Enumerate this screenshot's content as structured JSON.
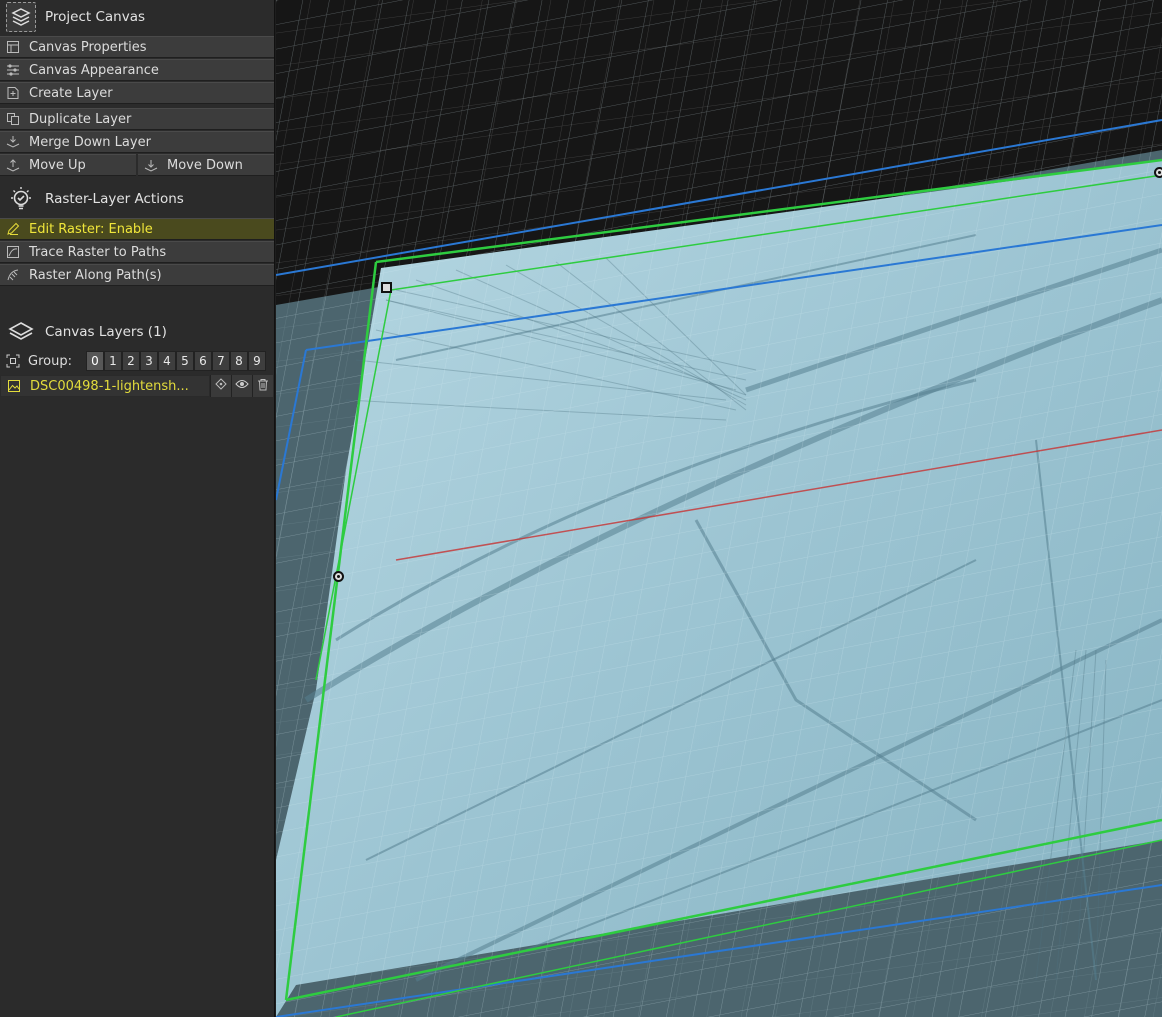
{
  "header": {
    "title": "Project Canvas",
    "icon": "canvas-stack-icon"
  },
  "canvas_actions": [
    {
      "label": "Canvas Properties",
      "icon": "canvas-properties-icon"
    },
    {
      "label": "Canvas Appearance",
      "icon": "sliders-icon"
    },
    {
      "label": "Create Layer",
      "icon": "create-layer-icon"
    },
    {
      "label": "Duplicate Layer",
      "icon": "duplicate-icon"
    },
    {
      "label": "Merge Down Layer",
      "icon": "merge-down-icon"
    }
  ],
  "move": {
    "up_label": "Move Up",
    "down_label": "Move Down"
  },
  "raster_section": {
    "title": "Raster-Layer Actions",
    "icon": "lightbulb-icon"
  },
  "raster_actions": [
    {
      "label": "Edit Raster: Enable",
      "icon": "pencil-icon",
      "active": true
    },
    {
      "label": "Trace Raster to Paths",
      "icon": "trace-icon"
    },
    {
      "label": "Raster Along Path(s)",
      "icon": "raster-path-icon"
    }
  ],
  "layers_section": {
    "title": "Canvas Layers (1)",
    "icon": "layers-icon"
  },
  "group": {
    "label": "Group:",
    "numbers": [
      "0",
      "1",
      "2",
      "3",
      "4",
      "5",
      "6",
      "7",
      "8",
      "9"
    ],
    "selected": "0"
  },
  "layer": {
    "name": "DSC00498-1-lightensh...",
    "icon": "image-layer-icon"
  },
  "colors": {
    "panel_bg": "#2b2b2b",
    "button_bg": "#3c3c3c",
    "active_text": "#f0e63a",
    "relief": "#9cc4d2",
    "green_frame": "#2ecc40",
    "blue_frame": "#2a78d4",
    "red_axis": "#c83232"
  }
}
